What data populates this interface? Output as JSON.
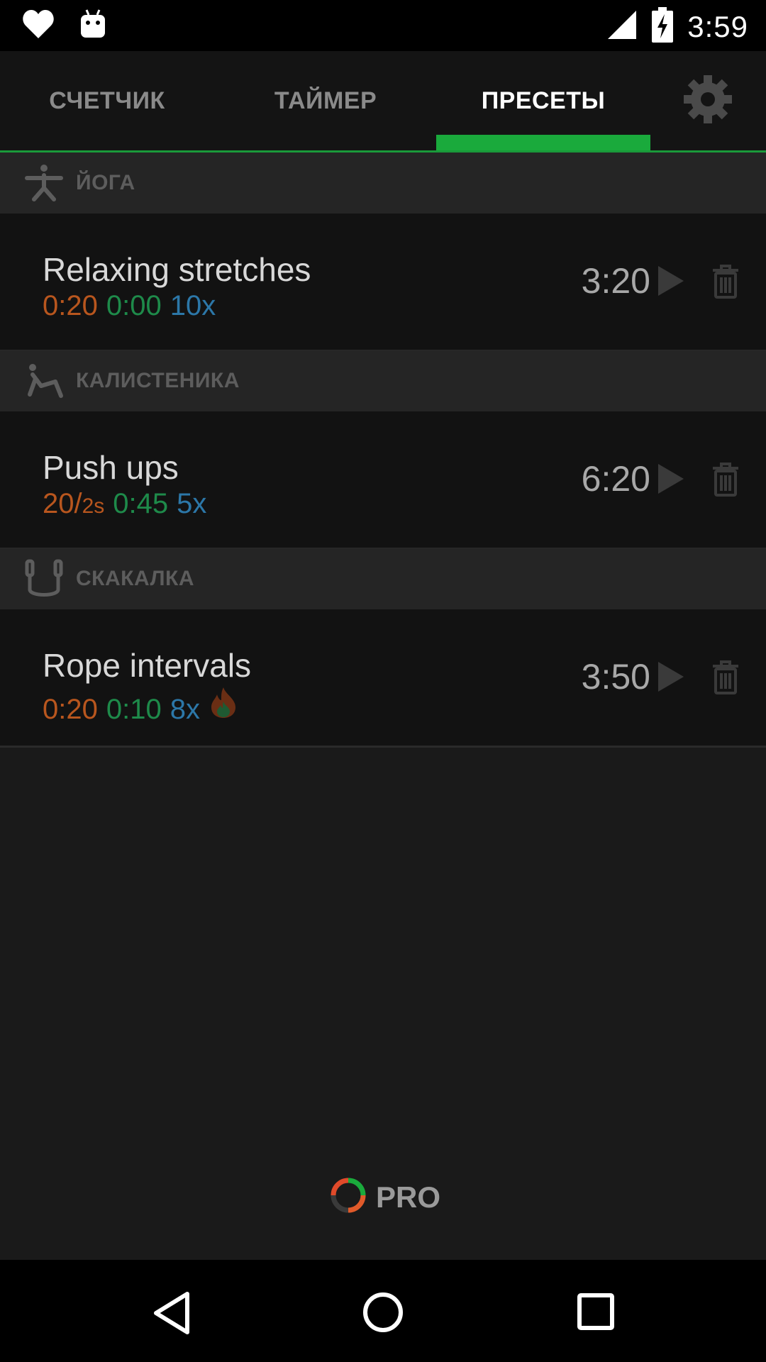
{
  "status_bar": {
    "time": "3:59",
    "icons": [
      "heart-icon",
      "android-icon",
      "signal-icon",
      "battery-charging-icon"
    ]
  },
  "tabs": [
    {
      "label": "СЧЕТЧИК",
      "active": false
    },
    {
      "label": "ТАЙМЕР",
      "active": false
    },
    {
      "label": "ПРЕСЕТЫ",
      "active": true
    }
  ],
  "settings_icon": "gear-icon",
  "colors": {
    "accent": "#1aaa3c",
    "work": "#b8561e",
    "rest": "#1e8a4a",
    "reps": "#2c77a8"
  },
  "sections": [
    {
      "label": "ЙОГА",
      "icon": "yoga-icon",
      "presets": [
        {
          "name": "Relaxing stretches",
          "work": "0:20",
          "work_suffix": "",
          "rest": "0:00",
          "reps": "10x",
          "duration": "3:20",
          "fire": false
        }
      ]
    },
    {
      "label": "КАЛИСТЕНИКА",
      "icon": "calisthenics-icon",
      "presets": [
        {
          "name": "Push ups",
          "work": "20/",
          "work_suffix": "2s",
          "rest": "0:45",
          "reps": "5x",
          "duration": "6:20",
          "fire": false
        }
      ]
    },
    {
      "label": "СКАКАЛКА",
      "icon": "jump-rope-icon",
      "presets": [
        {
          "name": "Rope intervals",
          "work": "0:20",
          "work_suffix": "",
          "rest": "0:10",
          "reps": "8x",
          "duration": "3:50",
          "fire": true
        }
      ]
    }
  ],
  "pro": {
    "label": "PRO"
  },
  "nav": [
    "back-icon",
    "home-icon",
    "recents-icon"
  ]
}
